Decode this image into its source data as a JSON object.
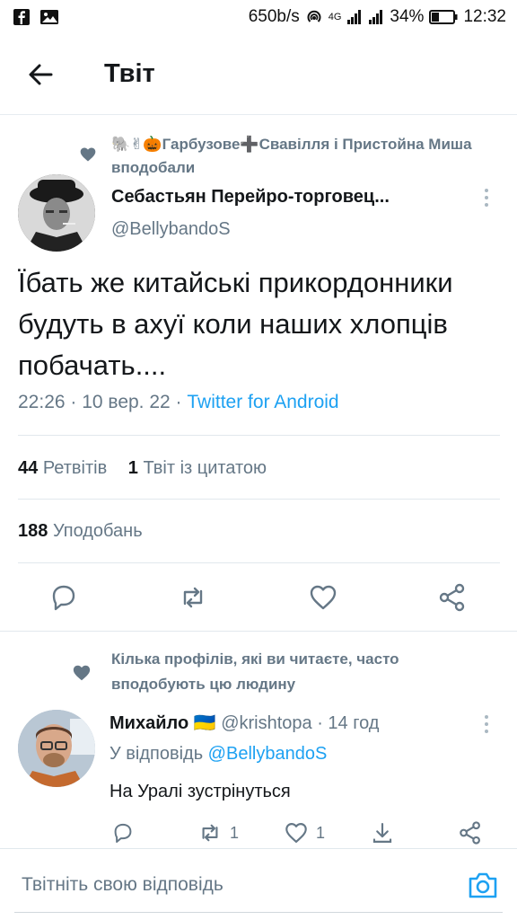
{
  "status_bar": {
    "speed": "650b/s",
    "network": "4G",
    "battery": "34%",
    "time": "12:32"
  },
  "header": {
    "title": "Твіт"
  },
  "tweet": {
    "social_context": "🐘✌🎃Гарбузове➕Свавілля і Пристойна Миша вподобали",
    "author_name": "Себастьян Перейро-торговец...",
    "author_handle": "@BellybandoS",
    "text": "Їбать же китайські прикордонники будуть в ахуї коли наших хлопців побачать....",
    "time_date": "22:26 · 10 вер. 22 · ",
    "source": "Twitter for Android",
    "retweets_count": "44",
    "retweets_label": "Ретвітів",
    "quotes_count": "1",
    "quotes_label": "Твіт із цитатою",
    "likes_count": "188",
    "likes_label": "Уподобань"
  },
  "reply": {
    "context": "Кілька профілів, які ви читаєте, часто вподобують цю людину",
    "name": "Михайло 🇺🇦",
    "handle": "@krishtopa · 14 год",
    "reply_to_prefix": "У відповідь ",
    "reply_to_mention": "@BellybandoS",
    "text": "На Уралі зустрінуться",
    "retweet_count": "1",
    "like_count": "1"
  },
  "compose": {
    "placeholder": "Твітніть свою відповідь"
  },
  "colors": {
    "accent": "#1da1f2",
    "secondary_text": "#657786",
    "primary_text": "#14171a"
  }
}
